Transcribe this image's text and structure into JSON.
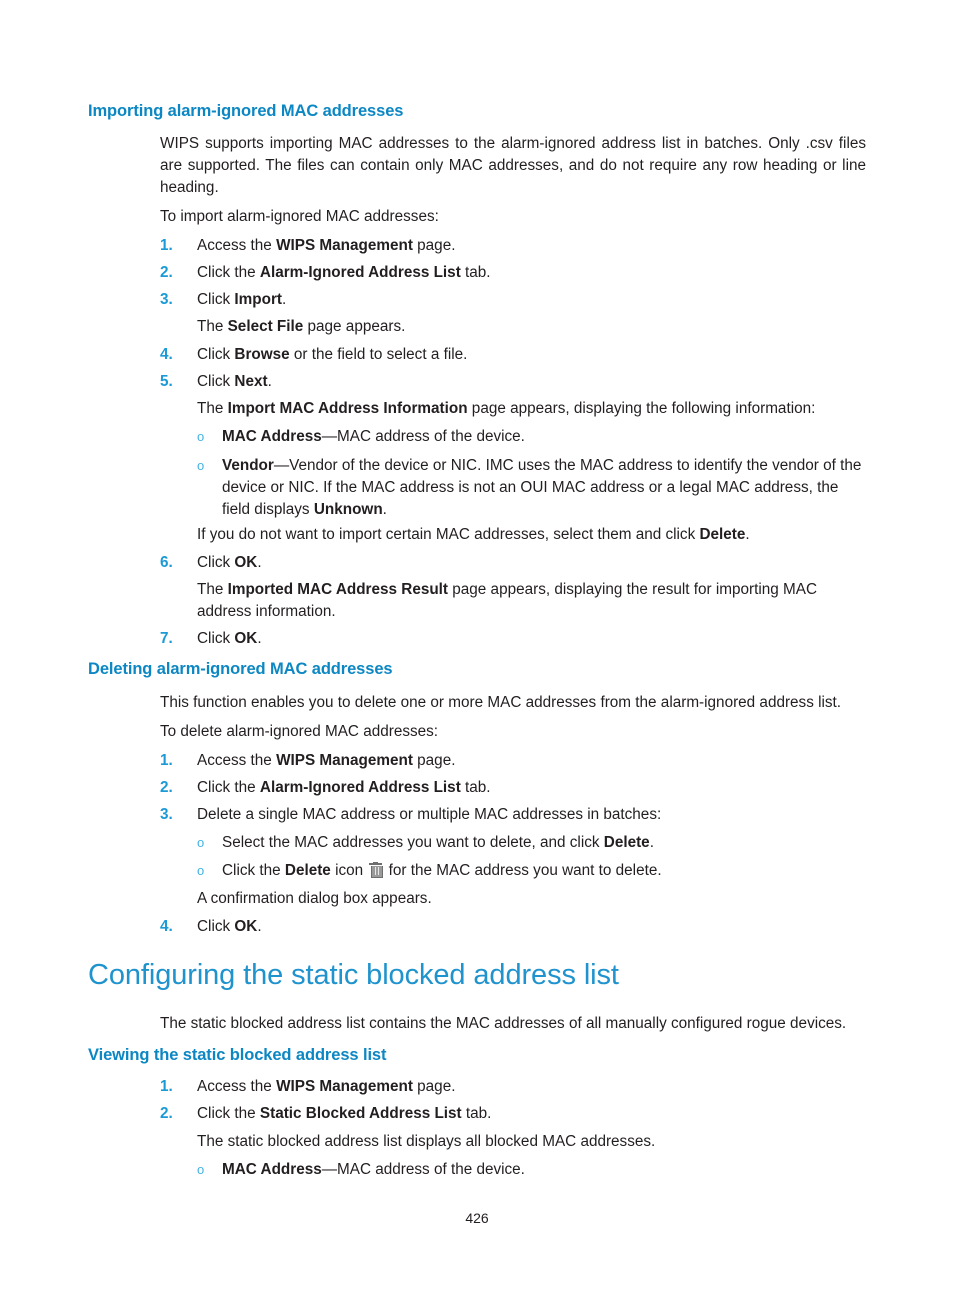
{
  "document": {
    "page_number": "426",
    "accent_heading_color": "#0c87c3",
    "accent_title_color": "#1f93cd",
    "list_marker_color": "#1b9ad6",
    "bullet_color": "#43b3e5"
  },
  "sections": {
    "importing": {
      "heading": "Importing alarm-ignored MAC addresses",
      "intro": "WIPS supports importing MAC addresses to the alarm-ignored address list in batches. Only .csv files are supported. The files can contain only MAC addresses, and do not require any row heading or line heading.",
      "lead_in": "To import alarm-ignored MAC addresses:",
      "steps": [
        {
          "num": "1.",
          "text_pre": "Access the ",
          "bold": "WIPS Management",
          "text_post": " page."
        },
        {
          "num": "2.",
          "text_pre": "Click the ",
          "bold": "Alarm-Ignored Address List",
          "text_post": " tab."
        },
        {
          "num": "3.",
          "text_pre": "Click ",
          "bold": "Import",
          "text_post": "."
        },
        {
          "num": "4.",
          "text_pre": "Click ",
          "bold": "Browse",
          "text_post": " or the field to select a file."
        },
        {
          "num": "5.",
          "text_pre": "Click ",
          "bold": "Next",
          "text_post": "."
        },
        {
          "num": "6.",
          "text_pre": "Click ",
          "bold": "OK",
          "text_post": "."
        },
        {
          "num": "7.",
          "text_pre": "Click ",
          "bold": "OK",
          "text_post": "."
        }
      ],
      "after_step3": {
        "pre": "The ",
        "bold": "Select File",
        "post": " page appears."
      },
      "after_step5": {
        "pre": "The ",
        "bold": "Import MAC Address Information",
        "post": " page appears, displaying the following information:"
      },
      "sub_bullets": [
        {
          "bullet": "o",
          "bold": "MAC Address",
          "rest": "—MAC address of the device."
        },
        {
          "bullet": "o",
          "bold": "Vendor",
          "rest_1": "—Vendor of the device or NIC. IMC uses the MAC address to identify the vendor of the device or NIC. If the MAC address is not an OUI MAC address or a legal MAC address, the field displays ",
          "bold_2": "Unknown",
          "rest_2": "."
        }
      ],
      "delete_note": {
        "pre": "If you do not want to import certain MAC addresses, select them and click ",
        "bold": "Delete",
        "post": "."
      },
      "after_step6": {
        "pre": "The ",
        "bold": "Imported MAC Address Result",
        "post": " page appears, displaying the result for importing MAC address information."
      }
    },
    "deleting": {
      "heading": "Deleting alarm-ignored MAC addresses",
      "intro": "This function enables you to delete one or more MAC addresses from the alarm-ignored address list.",
      "lead_in": "To delete alarm-ignored MAC addresses:",
      "steps": [
        {
          "num": "1.",
          "text_pre": "Access the ",
          "bold": "WIPS Management",
          "text_post": " page."
        },
        {
          "num": "2.",
          "text_pre": "Click the ",
          "bold": "Alarm-Ignored Address List",
          "text_post": " tab."
        },
        {
          "num": "3.",
          "text_pre": "Delete a single MAC address or multiple MAC addresses in batches:",
          "bold": "",
          "text_post": ""
        },
        {
          "num": "4.",
          "text_pre": "Click ",
          "bold": "OK",
          "text_post": "."
        }
      ],
      "sub_bullets": [
        {
          "bullet": "o",
          "pre": "Select the MAC addresses you want to delete, and click ",
          "bold": "Delete",
          "post": "."
        },
        {
          "bullet": "o",
          "pre": "Click the ",
          "bold": "Delete",
          "mid": " icon ",
          "icon": "trash-icon",
          "post": " for the MAC address you want to delete."
        }
      ],
      "confirmation": "A confirmation dialog box appears."
    },
    "configuring": {
      "title": "Configuring the static blocked address list",
      "intro": "The static blocked address list contains the MAC addresses of all manually configured rogue devices.",
      "viewing": {
        "heading": "Viewing the static blocked address list",
        "steps": [
          {
            "num": "1.",
            "text_pre": "Access the ",
            "bold": "WIPS Management",
            "text_post": " page."
          },
          {
            "num": "2.",
            "text_pre": "Click the ",
            "bold": "Static Blocked Address List",
            "text_post": " tab."
          }
        ],
        "note": "The static blocked address list displays all blocked MAC addresses.",
        "sub_bullets": [
          {
            "bullet": "o",
            "bold": "MAC Address",
            "rest": "—MAC address of the device."
          }
        ]
      }
    }
  }
}
